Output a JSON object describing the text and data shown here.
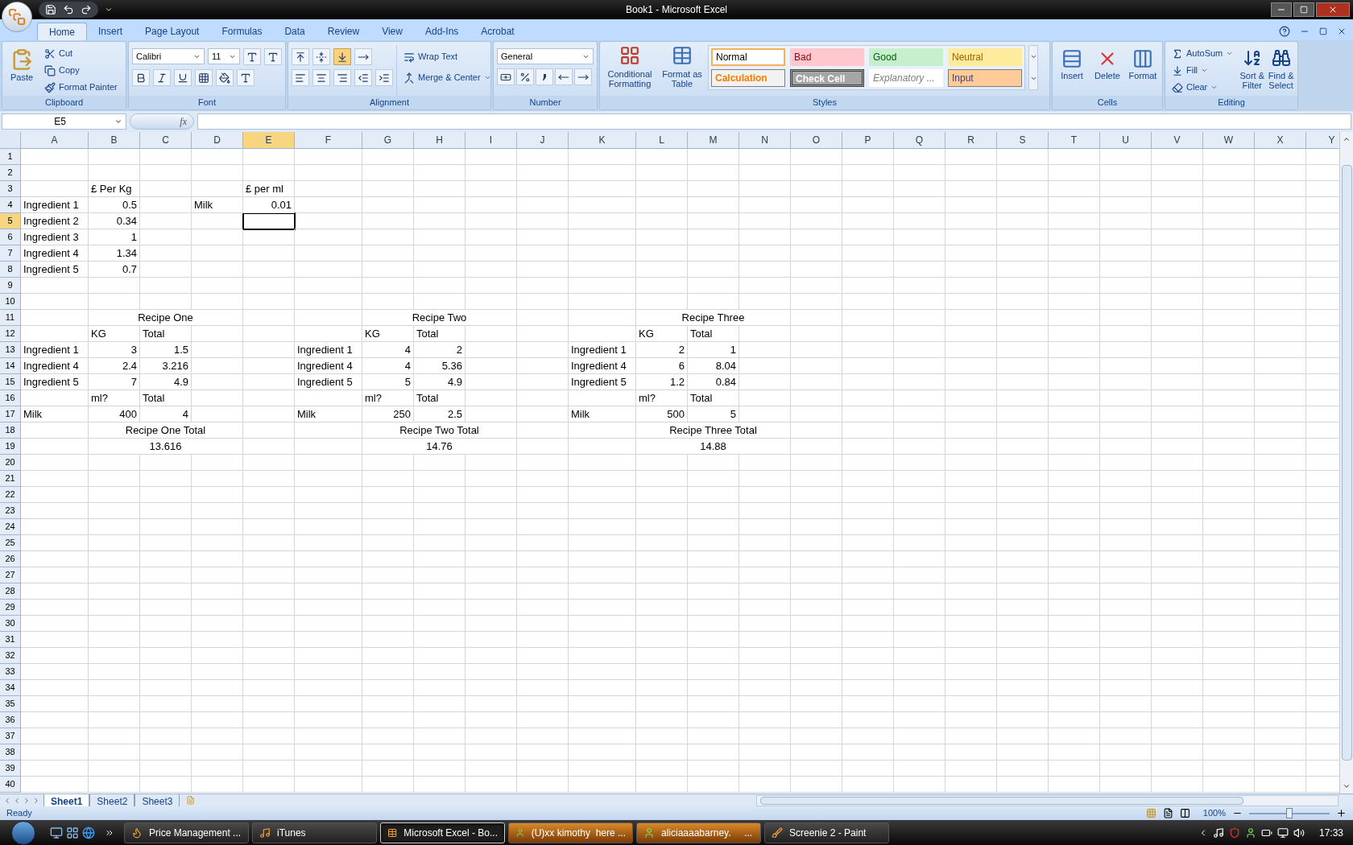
{
  "window": {
    "title": "Book1 - Microsoft Excel"
  },
  "ribbon": {
    "tabs": [
      {
        "label": "Home",
        "selected": true
      },
      {
        "label": "Insert",
        "selected": false
      },
      {
        "label": "Page Layout",
        "selected": false
      },
      {
        "label": "Formulas",
        "selected": false
      },
      {
        "label": "Data",
        "selected": false
      },
      {
        "label": "Review",
        "selected": false
      },
      {
        "label": "View",
        "selected": false
      },
      {
        "label": "Add-Ins",
        "selected": false
      },
      {
        "label": "Acrobat",
        "selected": false
      }
    ],
    "clipboard": {
      "label": "Clipboard",
      "paste": "Paste",
      "cut": "Cut",
      "copy": "Copy",
      "format_painter": "Format Painter"
    },
    "font": {
      "label": "Font",
      "font_name": "Calibri",
      "font_size": "11"
    },
    "alignment": {
      "label": "Alignment",
      "vertical_align": [
        {
          "selected": false
        },
        {
          "selected": false
        },
        {
          "selected": true
        }
      ],
      "wrap_text": "Wrap Text",
      "merge": "Merge & Center"
    },
    "number": {
      "label": "Number",
      "format": "General"
    },
    "styles": {
      "label": "Styles",
      "conditional": "Conditional Formatting",
      "format_table": "Format as Table",
      "cell_styles": [
        {
          "label": "Normal",
          "kind": "normal"
        },
        {
          "label": "Bad",
          "kind": "bad"
        },
        {
          "label": "Good",
          "kind": "good"
        },
        {
          "label": "Neutral",
          "kind": "neutral"
        },
        {
          "label": "Calculation",
          "kind": "calculation"
        },
        {
          "label": "Check Cell",
          "kind": "check"
        },
        {
          "label": "Explanatory ...",
          "kind": "explanatory"
        },
        {
          "label": "Input",
          "kind": "input"
        }
      ]
    },
    "cells": {
      "label": "Cells",
      "insert": "Insert",
      "delete": "Delete",
      "format": "Format"
    },
    "editing": {
      "label": "Editing",
      "autosum": "AutoSum",
      "fill": "Fill",
      "clear": "Clear",
      "sort": "Sort & Filter",
      "find": "Find & Select"
    }
  },
  "formula_bar": {
    "name_box": "E5",
    "fx": "fx"
  },
  "sheet": {
    "columns": [
      {
        "label": "A",
        "selected": false
      },
      {
        "label": "B",
        "selected": false
      },
      {
        "label": "C",
        "selected": false
      },
      {
        "label": "D",
        "selected": false
      },
      {
        "label": "E",
        "selected": true
      },
      {
        "label": "F",
        "selected": false
      },
      {
        "label": "G",
        "selected": false
      },
      {
        "label": "H",
        "selected": false
      },
      {
        "label": "I",
        "selected": false
      },
      {
        "label": "J",
        "selected": false
      },
      {
        "label": "K",
        "selected": false
      },
      {
        "label": "L",
        "selected": false
      },
      {
        "label": "M",
        "selected": false
      },
      {
        "label": "N",
        "selected": false
      },
      {
        "label": "O",
        "selected": false
      },
      {
        "label": "P",
        "selected": false
      },
      {
        "label": "Q",
        "selected": false
      },
      {
        "label": "R",
        "selected": false
      },
      {
        "label": "S",
        "selected": false
      },
      {
        "label": "T",
        "selected": false
      },
      {
        "label": "U",
        "selected": false
      },
      {
        "label": "V",
        "selected": false
      },
      {
        "label": "W",
        "selected": false
      },
      {
        "label": "X",
        "selected": false
      },
      {
        "label": "Y",
        "selected": false
      }
    ],
    "rows": [
      {
        "label": "1",
        "selected": false
      },
      {
        "label": "2",
        "selected": false
      },
      {
        "label": "3",
        "selected": false,
        "cells": {
          "B": {
            "text": "£ Per Kg",
            "kind": "text"
          },
          "E": {
            "text": "£ per ml",
            "kind": "text"
          }
        }
      },
      {
        "label": "4",
        "selected": false,
        "cells": {
          "A": {
            "text": "Ingredient 1",
            "kind": "text"
          },
          "B": {
            "text": "0.5",
            "kind": "number"
          },
          "D": {
            "text": "Milk",
            "kind": "text"
          },
          "E": {
            "text": "0.01",
            "kind": "number"
          }
        }
      },
      {
        "label": "5",
        "selected": true,
        "cells": {
          "A": {
            "text": "Ingredient 2",
            "kind": "text"
          },
          "B": {
            "text": "0.34",
            "kind": "number"
          }
        }
      },
      {
        "label": "6",
        "selected": false,
        "cells": {
          "A": {
            "text": "Ingredient 3",
            "kind": "text"
          },
          "B": {
            "text": "1",
            "kind": "number"
          }
        }
      },
      {
        "label": "7",
        "selected": false,
        "cells": {
          "A": {
            "text": "Ingredient 4",
            "kind": "text"
          },
          "B": {
            "text": "1.34",
            "kind": "number"
          }
        }
      },
      {
        "label": "8",
        "selected": false,
        "cells": {
          "A": {
            "text": "Ingredient 5",
            "kind": "text"
          },
          "B": {
            "text": "0.7",
            "kind": "number"
          }
        }
      },
      {
        "label": "9",
        "selected": false
      },
      {
        "label": "10",
        "selected": false
      },
      {
        "label": "11",
        "selected": false,
        "cells": {
          "C": {
            "text": "Recipe One",
            "kind": "center"
          },
          "H": {
            "text": "Recipe Two",
            "kind": "center"
          },
          "M": {
            "text": "Recipe Three",
            "kind": "center"
          }
        }
      },
      {
        "label": "12",
        "selected": false,
        "cells": {
          "B": {
            "text": "KG",
            "kind": "text"
          },
          "C": {
            "text": "Total",
            "kind": "text"
          },
          "G": {
            "text": "KG",
            "kind": "text"
          },
          "H": {
            "text": "Total",
            "kind": "text"
          },
          "L": {
            "text": "KG",
            "kind": "text"
          },
          "M": {
            "text": "Total",
            "kind": "text"
          }
        }
      },
      {
        "label": "13",
        "selected": false,
        "cells": {
          "A": {
            "text": "Ingredient 1",
            "kind": "text"
          },
          "B": {
            "text": "3",
            "kind": "number"
          },
          "C": {
            "text": "1.5",
            "kind": "number"
          },
          "F": {
            "text": "Ingredient 1",
            "kind": "text"
          },
          "G": {
            "text": "4",
            "kind": "number"
          },
          "H": {
            "text": "2",
            "kind": "number"
          },
          "K": {
            "text": "Ingredient 1",
            "kind": "text"
          },
          "L": {
            "text": "2",
            "kind": "number"
          },
          "M": {
            "text": "1",
            "kind": "number"
          }
        }
      },
      {
        "label": "14",
        "selected": false,
        "cells": {
          "A": {
            "text": "Ingredient 4",
            "kind": "text"
          },
          "B": {
            "text": "2.4",
            "kind": "number"
          },
          "C": {
            "text": "3.216",
            "kind": "number"
          },
          "F": {
            "text": "Ingredient 4",
            "kind": "text"
          },
          "G": {
            "text": "4",
            "kind": "number"
          },
          "H": {
            "text": "5.36",
            "kind": "number"
          },
          "K": {
            "text": "Ingredient 4",
            "kind": "text"
          },
          "L": {
            "text": "6",
            "kind": "number"
          },
          "M": {
            "text": "8.04",
            "kind": "number"
          }
        }
      },
      {
        "label": "15",
        "selected": false,
        "cells": {
          "A": {
            "text": "Ingredient 5",
            "kind": "text"
          },
          "B": {
            "text": "7",
            "kind": "number"
          },
          "C": {
            "text": "4.9",
            "kind": "number"
          },
          "F": {
            "text": "Ingredient 5",
            "kind": "text"
          },
          "G": {
            "text": "5",
            "kind": "number"
          },
          "H": {
            "text": "4.9",
            "kind": "number"
          },
          "K": {
            "text": "Ingredient 5",
            "kind": "text"
          },
          "L": {
            "text": "1.2",
            "kind": "number"
          },
          "M": {
            "text": "0.84",
            "kind": "number"
          }
        }
      },
      {
        "label": "16",
        "selected": false,
        "cells": {
          "B": {
            "text": "ml?",
            "kind": "text"
          },
          "C": {
            "text": "Total",
            "kind": "text"
          },
          "G": {
            "text": "ml?",
            "kind": "text"
          },
          "H": {
            "text": "Total",
            "kind": "text"
          },
          "L": {
            "text": "ml?",
            "kind": "text"
          },
          "M": {
            "text": "Total",
            "kind": "text"
          }
        }
      },
      {
        "label": "17",
        "selected": false,
        "cells": {
          "A": {
            "text": "Milk",
            "kind": "text"
          },
          "B": {
            "text": "400",
            "kind": "number"
          },
          "C": {
            "text": "4",
            "kind": "number"
          },
          "F": {
            "text": "Milk",
            "kind": "text"
          },
          "G": {
            "text": "250",
            "kind": "number"
          },
          "H": {
            "text": "2.5",
            "kind": "number"
          },
          "K": {
            "text": "Milk",
            "kind": "text"
          },
          "L": {
            "text": "500",
            "kind": "number"
          },
          "M": {
            "text": "5",
            "kind": "number"
          }
        }
      },
      {
        "label": "18",
        "selected": false,
        "cells": {
          "C": {
            "text": "Recipe One Total",
            "kind": "center"
          },
          "H": {
            "text": "Recipe Two Total",
            "kind": "center"
          },
          "M": {
            "text": "Recipe Three Total",
            "kind": "center"
          }
        }
      },
      {
        "label": "19",
        "selected": false,
        "cells": {
          "C": {
            "text": "13.616",
            "kind": "center"
          },
          "H": {
            "text": "14.76",
            "kind": "center"
          },
          "M": {
            "text": "14.88",
            "kind": "center"
          }
        }
      },
      {
        "label": "20",
        "selected": false
      },
      {
        "label": "21",
        "selected": false
      },
      {
        "label": "22",
        "selected": false
      },
      {
        "label": "23",
        "selected": false
      },
      {
        "label": "24",
        "selected": false
      },
      {
        "label": "25",
        "selected": false
      },
      {
        "label": "26",
        "selected": false
      },
      {
        "label": "27",
        "selected": false
      },
      {
        "label": "28",
        "selected": false
      },
      {
        "label": "29",
        "selected": false
      },
      {
        "label": "30",
        "selected": false
      },
      {
        "label": "31",
        "selected": false
      },
      {
        "label": "32",
        "selected": false
      },
      {
        "label": "33",
        "selected": false
      },
      {
        "label": "34",
        "selected": false
      },
      {
        "label": "35",
        "selected": false
      },
      {
        "label": "36",
        "selected": false
      },
      {
        "label": "37",
        "selected": false
      },
      {
        "label": "38",
        "selected": false
      },
      {
        "label": "39",
        "selected": false
      },
      {
        "label": "40",
        "selected": false
      }
    ]
  },
  "sheet_tabs": [
    {
      "label": "Sheet1",
      "selected": true
    },
    {
      "label": "Sheet2",
      "selected": false
    },
    {
      "label": "Sheet3",
      "selected": false
    }
  ],
  "status_bar": {
    "text": "Ready",
    "zoom": "100%",
    "zoom_level": {
      "level": 0.5
    }
  },
  "taskbar": {
    "items": [
      {
        "label": "Price Management ...",
        "kind": "window",
        "selected": false
      },
      {
        "label": "iTunes",
        "kind": "window",
        "selected": false
      },
      {
        "label": "Microsoft Excel - Bo...",
        "kind": "window",
        "selected": true
      },
      {
        "label": "(U)xx kimothy  here ...",
        "kind": "flashing",
        "selected": false
      },
      {
        "label": "aliciaaaabarney.     ...",
        "kind": "flashing",
        "selected": false
      },
      {
        "label": "Screenie 2 - Paint",
        "kind": "window",
        "selected": false
      }
    ],
    "clock": "17:33"
  }
}
